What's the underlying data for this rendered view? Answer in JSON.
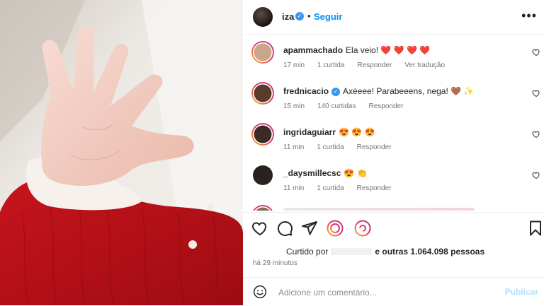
{
  "post": {
    "username": "iza",
    "dot": "•",
    "follow_label": "Seguir",
    "more_label": "•••"
  },
  "comments": [
    {
      "user": "apammachado",
      "text": "Ela veio! ❤️ ❤️ ❤️ ❤️",
      "time": "17 min",
      "likes": "1 curtida",
      "reply": "Responder",
      "translate": "Ver tradução",
      "avatar_color": "#c9a68a"
    },
    {
      "user": "frednicacio",
      "text": "Axéeee! Parabeeens, nega! 🤎 ✨",
      "time": "15 min",
      "likes": "140 curtidas",
      "reply": "Responder",
      "verified": true,
      "avatar_color": "#5a3a2a"
    },
    {
      "user": "ingridaguiarr",
      "text": "😍 😍 😍",
      "time": "11 min",
      "likes": "1 curtida",
      "reply": "Responder",
      "avatar_color": "#3b2a26"
    },
    {
      "user": "_daysmillecsc",
      "text": "😍 👏",
      "time": "11 min",
      "likes": "1 curtida",
      "reply": "Responder",
      "avatar_color": "#2a2220"
    }
  ],
  "likes": {
    "prefix": "Curtido por",
    "suffix": "e outras 1.064.098 pessoas"
  },
  "time_ago": "há 29 minutos",
  "add_comment": {
    "placeholder": "Adicione um comentário...",
    "publish_label": "Publicar"
  },
  "colors": {
    "link_blue": "#0095f6",
    "verified_blue": "#3897f0",
    "publish_disabled": "#b2dffc",
    "story_ring": "#d6249f"
  }
}
